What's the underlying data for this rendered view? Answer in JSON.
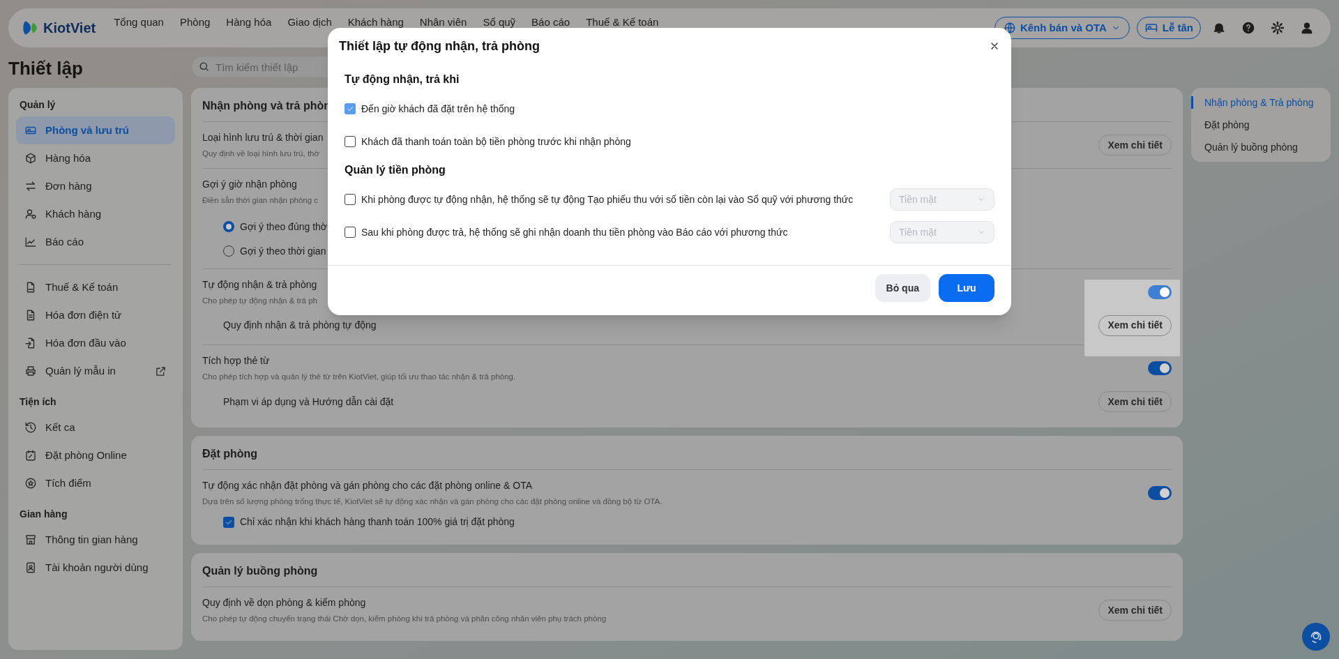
{
  "top_nav": {
    "logo": "KiotViet",
    "items": [
      "Tổng quan",
      "Phòng",
      "Hàng hóa",
      "Giao dịch",
      "Khách hàng",
      "Nhân viên",
      "Sổ quỹ",
      "Báo cáo",
      "Thuế & Kế toán"
    ],
    "channel_button": "Kênh bán và OTA",
    "reception_button": "Lễ tân"
  },
  "page_title": "Thiết lập",
  "search": {
    "placeholder": "Tìm kiếm thiết lập"
  },
  "sidebar": [
    {
      "title": "Quản lý",
      "items": [
        {
          "label": "Phòng và lưu trú",
          "selected": true
        },
        {
          "label": "Hàng hóa",
          "selected": false
        },
        {
          "label": "Đơn hàng",
          "selected": false
        },
        {
          "label": "Khách hàng",
          "selected": false
        },
        {
          "label": "Báo cáo",
          "selected": false
        }
      ]
    },
    {
      "items": [
        {
          "label": "Thuế & Kế toán",
          "selected": false
        },
        {
          "label": "Hóa đơn điện tử",
          "selected": false
        },
        {
          "label": "Hóa đơn đầu vào",
          "selected": false
        },
        {
          "label": "Quản lý mẫu in",
          "selected": false,
          "external": true
        }
      ]
    },
    {
      "title": "Tiện ích",
      "items": [
        {
          "label": "Kết ca",
          "selected": false
        },
        {
          "label": "Đặt phòng Online",
          "selected": false
        },
        {
          "label": "Tích điểm",
          "selected": false
        }
      ]
    },
    {
      "title": "Gian hàng",
      "items": [
        {
          "label": "Thông tin gian hàng",
          "selected": false
        },
        {
          "label": "Tài khoản người dùng",
          "selected": false
        }
      ]
    }
  ],
  "sections": [
    {
      "title": "Nhận phòng và trả phòn",
      "rows": [
        {
          "title": "Loại hình lưu trú & thời gian",
          "description": "Quy định về loại hình lưu trú, thờ",
          "button": "Xem chi tiết"
        },
        {
          "title": "Gợi ý giờ nhận phòng",
          "description": "Điền sẵn thời gian nhận phòng c",
          "radios": [
            {
              "label": "Gợi ý theo đúng thờ",
              "selected": true
            },
            {
              "label": "Gợi ý theo thời gian",
              "selected": false
            }
          ]
        },
        {
          "title": "Tự động nhận & trả phòng",
          "description": "Cho phép tự động nhận & trả ph",
          "spotlight": true,
          "toggle": {
            "on": true
          },
          "sub": {
            "label": "Quy định nhận & trả phòng tự động",
            "button": "Xem chi tiết"
          }
        },
        {
          "title": "Tích hợp thẻ từ",
          "description": "Cho phép tích hợp và quản lý thẻ từ trên KiotViet, giúp tối ưu thao tác nhận & trả phòng.",
          "toggle": {
            "on": true
          },
          "sub": {
            "label": "Phạm vi áp dụng và Hướng dẫn cài đặt",
            "button": "Xem chi tiết"
          }
        }
      ]
    },
    {
      "title": "Đặt phòng",
      "rows": [
        {
          "title": "Tự động xác nhận đặt phòng và gán phòng cho các đặt phòng online & OTA",
          "description": "Dựa trên số lượng phòng trống thực tế, KiotViet sẽ tự động xác nhận và gán phòng cho các đặt phòng online và đồng bộ từ OTA.",
          "toggle": {
            "on": true
          },
          "checkbox": {
            "label": "Chỉ xác nhận khi khách hàng thanh toán 100% giá trị đặt phòng",
            "checked": true
          }
        }
      ]
    },
    {
      "title": "Quản lý buồng phòng",
      "rows": [
        {
          "title": "Quy định về dọn phòng & kiểm phòng",
          "description": "Cho phép tự động chuyển trạng thái Chờ dọn, kiểm phòng khi trả phòng và phân công nhân viên phụ trách phòng",
          "button": "Xem chi tiết"
        }
      ]
    }
  ],
  "anchors": [
    {
      "label": "Nhận phòng & Trả phòng",
      "selected": true
    },
    {
      "label": "Đặt phòng",
      "selected": false
    },
    {
      "label": "Quản lý buồng phòng",
      "selected": false
    }
  ],
  "modal": {
    "title": "Thiết lập tự động nhận, trả phòng",
    "sections": [
      {
        "heading": "Tự động nhận, trả khi",
        "options": [
          {
            "label": "Đến giờ khách đã đặt trên hệ thống",
            "checked": true
          },
          {
            "label": "Khách đã thanh toán toàn bộ tiền phòng trước khi nhận phòng",
            "checked": false
          }
        ]
      },
      {
        "heading": "Quản lý tiền phòng",
        "options": [
          {
            "label": "Khi phòng được tự động nhận, hệ thống sẽ tự động Tạo phiếu thu với số tiền còn lại vào Sổ quỹ với phương thức",
            "checked": false,
            "select": {
              "value": "Tiền mặt",
              "disabled": true
            }
          },
          {
            "label": "Sau khi phòng được trả, hệ thống sẽ ghi nhận doanh thu tiền phòng vào Báo cáo với phương thức",
            "checked": false,
            "select": {
              "value": "Tiền mặt",
              "disabled": true
            }
          }
        ]
      }
    ],
    "cancel_button": "Bỏ qua",
    "save_button": "Lưu"
  }
}
